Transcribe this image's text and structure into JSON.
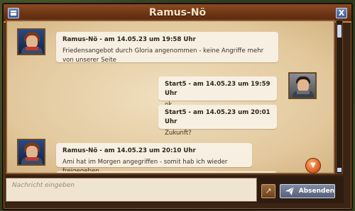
{
  "window": {
    "title": "Ramus-Nö",
    "close_label": "X"
  },
  "messages": [
    {
      "side": "left",
      "header": "Ramus-Nö - am 14.05.23 um 19:58 Uhr",
      "text": "Friedensangebot durch Gloria angenommen - keine Angriffe mehr von unserer Seite"
    },
    {
      "side": "right",
      "header": "Start5 - am 14.05.23 um 19:59 Uhr",
      "text": "ok"
    },
    {
      "side": "right",
      "header": "Start5 - am 14.05.23 um 20:01 Uhr",
      "text": "Zukunft?"
    },
    {
      "side": "left",
      "header": "Ramus-Nö - am 14.05.23 um 20:10 Uhr",
      "text": "Ami hat im Morgen angegriffen - somit hab ich wieder freigegeben"
    }
  ],
  "composer": {
    "placeholder": "Nachricht eingeben",
    "send_label": "Absenden"
  },
  "icons": {
    "menu": "menu-icon",
    "close": "close-icon",
    "scroll_down": "chevron-down-icon",
    "attach": "attach-icon",
    "send": "paper-plane-icon"
  },
  "colors": {
    "title_bar": "#6a3314",
    "parchment": "#e2c89c",
    "bubble": "#f7f0e2",
    "accent_button": "#56607a",
    "scroll_fab": "#e0642a"
  }
}
